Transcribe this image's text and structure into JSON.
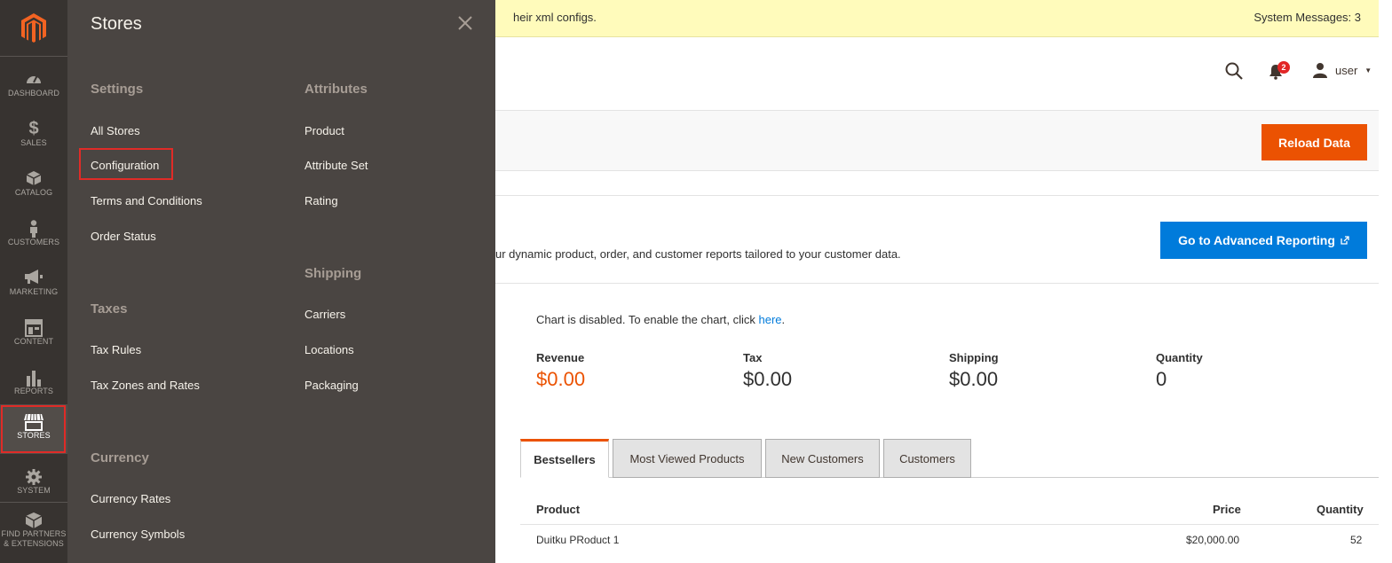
{
  "nav": {
    "items": [
      {
        "label": "DASHBOARD",
        "icon": "dashboard-icon"
      },
      {
        "label": "SALES",
        "icon": "dollar-icon"
      },
      {
        "label": "CATALOG",
        "icon": "box-icon"
      },
      {
        "label": "CUSTOMERS",
        "icon": "person-icon"
      },
      {
        "label": "MARKETING",
        "icon": "megaphone-icon"
      },
      {
        "label": "CONTENT",
        "icon": "layout-icon"
      },
      {
        "label": "REPORTS",
        "icon": "bar-chart-icon"
      },
      {
        "label": "STORES",
        "icon": "store-icon"
      },
      {
        "label": "SYSTEM",
        "icon": "gear-icon"
      },
      {
        "label_line1": "FIND PARTNERS",
        "label_line2": "& EXTENSIONS",
        "icon": "partners-icon"
      }
    ]
  },
  "flyout": {
    "title": "Stores",
    "settings": {
      "heading": "Settings",
      "links": [
        "All Stores",
        "Configuration",
        "Terms and Conditions",
        "Order Status"
      ]
    },
    "taxes": {
      "heading": "Taxes",
      "links": [
        "Tax Rules",
        "Tax Zones and Rates"
      ]
    },
    "currency": {
      "heading": "Currency",
      "links": [
        "Currency Rates",
        "Currency Symbols"
      ]
    },
    "attributes": {
      "heading": "Attributes",
      "links": [
        "Product",
        "Attribute Set",
        "Rating"
      ]
    },
    "shipping": {
      "heading": "Shipping",
      "links": [
        "Carriers",
        "Locations",
        "Packaging"
      ]
    }
  },
  "message_bar": {
    "text": "heir xml configs.",
    "system_messages": "System Messages: 3"
  },
  "header": {
    "notifications_count": "2",
    "user": "user"
  },
  "actions": {
    "reload": "Reload Data"
  },
  "advanced": {
    "description": "ur dynamic product, order, and customer reports tailored to your customer data.",
    "button": "Go to Advanced Reporting"
  },
  "chart_notice": {
    "text": "Chart is disabled. To enable the chart, click ",
    "link": "here",
    "suffix": "."
  },
  "stats": [
    {
      "label": "Revenue",
      "value": "$0.00"
    },
    {
      "label": "Tax",
      "value": "$0.00"
    },
    {
      "label": "Shipping",
      "value": "$0.00"
    },
    {
      "label": "Quantity",
      "value": "0"
    }
  ],
  "tabs": [
    "Bestsellers",
    "Most Viewed Products",
    "New Customers",
    "Customers"
  ],
  "table": {
    "headers": [
      "Product",
      "Price",
      "Quantity"
    ],
    "rows": [
      {
        "product": "Duitku PRoduct 1",
        "price": "$20,000.00",
        "quantity": "52"
      }
    ]
  },
  "colors": {
    "accent": "#eb5202",
    "link": "#007bdb",
    "highlight_outline": "#e02b27"
  }
}
